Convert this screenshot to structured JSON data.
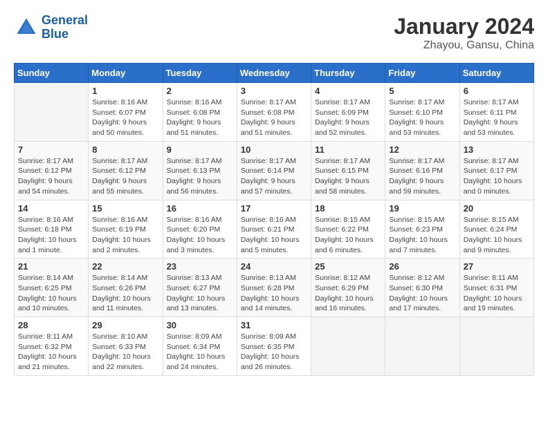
{
  "logo": {
    "line1": "General",
    "line2": "Blue"
  },
  "title": "January 2024",
  "subtitle": "Zhayou, Gansu, China",
  "header_days": [
    "Sunday",
    "Monday",
    "Tuesday",
    "Wednesday",
    "Thursday",
    "Friday",
    "Saturday"
  ],
  "weeks": [
    [
      {
        "day": "",
        "sunrise": "",
        "sunset": "",
        "daylight": ""
      },
      {
        "day": "1",
        "sunrise": "Sunrise: 8:16 AM",
        "sunset": "Sunset: 6:07 PM",
        "daylight": "Daylight: 9 hours and 50 minutes."
      },
      {
        "day": "2",
        "sunrise": "Sunrise: 8:16 AM",
        "sunset": "Sunset: 6:08 PM",
        "daylight": "Daylight: 9 hours and 51 minutes."
      },
      {
        "day": "3",
        "sunrise": "Sunrise: 8:17 AM",
        "sunset": "Sunset: 6:08 PM",
        "daylight": "Daylight: 9 hours and 51 minutes."
      },
      {
        "day": "4",
        "sunrise": "Sunrise: 8:17 AM",
        "sunset": "Sunset: 6:09 PM",
        "daylight": "Daylight: 9 hours and 52 minutes."
      },
      {
        "day": "5",
        "sunrise": "Sunrise: 8:17 AM",
        "sunset": "Sunset: 6:10 PM",
        "daylight": "Daylight: 9 hours and 53 minutes."
      },
      {
        "day": "6",
        "sunrise": "Sunrise: 8:17 AM",
        "sunset": "Sunset: 6:11 PM",
        "daylight": "Daylight: 9 hours and 53 minutes."
      }
    ],
    [
      {
        "day": "7",
        "sunrise": "Sunrise: 8:17 AM",
        "sunset": "Sunset: 6:12 PM",
        "daylight": "Daylight: 9 hours and 54 minutes."
      },
      {
        "day": "8",
        "sunrise": "Sunrise: 8:17 AM",
        "sunset": "Sunset: 6:12 PM",
        "daylight": "Daylight: 9 hours and 55 minutes."
      },
      {
        "day": "9",
        "sunrise": "Sunrise: 8:17 AM",
        "sunset": "Sunset: 6:13 PM",
        "daylight": "Daylight: 9 hours and 56 minutes."
      },
      {
        "day": "10",
        "sunrise": "Sunrise: 8:17 AM",
        "sunset": "Sunset: 6:14 PM",
        "daylight": "Daylight: 9 hours and 57 minutes."
      },
      {
        "day": "11",
        "sunrise": "Sunrise: 8:17 AM",
        "sunset": "Sunset: 6:15 PM",
        "daylight": "Daylight: 9 hours and 58 minutes."
      },
      {
        "day": "12",
        "sunrise": "Sunrise: 8:17 AM",
        "sunset": "Sunset: 6:16 PM",
        "daylight": "Daylight: 9 hours and 59 minutes."
      },
      {
        "day": "13",
        "sunrise": "Sunrise: 8:17 AM",
        "sunset": "Sunset: 6:17 PM",
        "daylight": "Daylight: 10 hours and 0 minutes."
      }
    ],
    [
      {
        "day": "14",
        "sunrise": "Sunrise: 8:16 AM",
        "sunset": "Sunset: 6:18 PM",
        "daylight": "Daylight: 10 hours and 1 minute."
      },
      {
        "day": "15",
        "sunrise": "Sunrise: 8:16 AM",
        "sunset": "Sunset: 6:19 PM",
        "daylight": "Daylight: 10 hours and 2 minutes."
      },
      {
        "day": "16",
        "sunrise": "Sunrise: 8:16 AM",
        "sunset": "Sunset: 6:20 PM",
        "daylight": "Daylight: 10 hours and 3 minutes."
      },
      {
        "day": "17",
        "sunrise": "Sunrise: 8:16 AM",
        "sunset": "Sunset: 6:21 PM",
        "daylight": "Daylight: 10 hours and 5 minutes."
      },
      {
        "day": "18",
        "sunrise": "Sunrise: 8:15 AM",
        "sunset": "Sunset: 6:22 PM",
        "daylight": "Daylight: 10 hours and 6 minutes."
      },
      {
        "day": "19",
        "sunrise": "Sunrise: 8:15 AM",
        "sunset": "Sunset: 6:23 PM",
        "daylight": "Daylight: 10 hours and 7 minutes."
      },
      {
        "day": "20",
        "sunrise": "Sunrise: 8:15 AM",
        "sunset": "Sunset: 6:24 PM",
        "daylight": "Daylight: 10 hours and 9 minutes."
      }
    ],
    [
      {
        "day": "21",
        "sunrise": "Sunrise: 8:14 AM",
        "sunset": "Sunset: 6:25 PM",
        "daylight": "Daylight: 10 hours and 10 minutes."
      },
      {
        "day": "22",
        "sunrise": "Sunrise: 8:14 AM",
        "sunset": "Sunset: 6:26 PM",
        "daylight": "Daylight: 10 hours and 11 minutes."
      },
      {
        "day": "23",
        "sunrise": "Sunrise: 8:13 AM",
        "sunset": "Sunset: 6:27 PM",
        "daylight": "Daylight: 10 hours and 13 minutes."
      },
      {
        "day": "24",
        "sunrise": "Sunrise: 8:13 AM",
        "sunset": "Sunset: 6:28 PM",
        "daylight": "Daylight: 10 hours and 14 minutes."
      },
      {
        "day": "25",
        "sunrise": "Sunrise: 8:12 AM",
        "sunset": "Sunset: 6:29 PM",
        "daylight": "Daylight: 10 hours and 16 minutes."
      },
      {
        "day": "26",
        "sunrise": "Sunrise: 8:12 AM",
        "sunset": "Sunset: 6:30 PM",
        "daylight": "Daylight: 10 hours and 17 minutes."
      },
      {
        "day": "27",
        "sunrise": "Sunrise: 8:11 AM",
        "sunset": "Sunset: 6:31 PM",
        "daylight": "Daylight: 10 hours and 19 minutes."
      }
    ],
    [
      {
        "day": "28",
        "sunrise": "Sunrise: 8:11 AM",
        "sunset": "Sunset: 6:32 PM",
        "daylight": "Daylight: 10 hours and 21 minutes."
      },
      {
        "day": "29",
        "sunrise": "Sunrise: 8:10 AM",
        "sunset": "Sunset: 6:33 PM",
        "daylight": "Daylight: 10 hours and 22 minutes."
      },
      {
        "day": "30",
        "sunrise": "Sunrise: 8:09 AM",
        "sunset": "Sunset: 6:34 PM",
        "daylight": "Daylight: 10 hours and 24 minutes."
      },
      {
        "day": "31",
        "sunrise": "Sunrise: 8:09 AM",
        "sunset": "Sunset: 6:35 PM",
        "daylight": "Daylight: 10 hours and 26 minutes."
      },
      {
        "day": "",
        "sunrise": "",
        "sunset": "",
        "daylight": ""
      },
      {
        "day": "",
        "sunrise": "",
        "sunset": "",
        "daylight": ""
      },
      {
        "day": "",
        "sunrise": "",
        "sunset": "",
        "daylight": ""
      }
    ]
  ]
}
